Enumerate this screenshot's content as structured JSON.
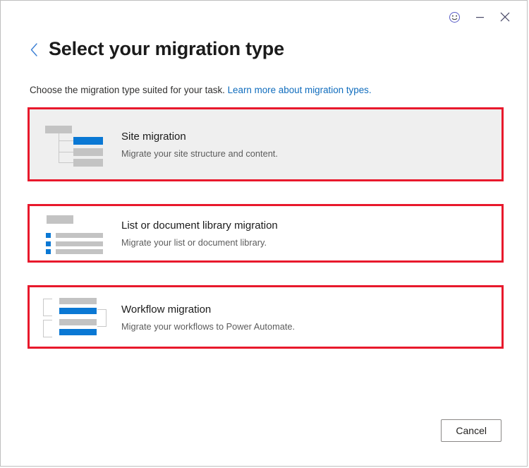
{
  "window": {
    "controls": [
      {
        "name": "feedback-smiley-button",
        "icon": "smiley-icon",
        "title": "Send feedback"
      },
      {
        "name": "minimize-button",
        "icon": "minimize-icon",
        "title": "Minimize"
      },
      {
        "name": "close-button",
        "icon": "close-icon",
        "title": "Close"
      }
    ]
  },
  "header": {
    "back_icon": "chevron-left-icon",
    "title": "Select your migration type"
  },
  "subtitle": {
    "text": "Choose the migration type suited for your task. ",
    "link_text": "Learn more about migration types."
  },
  "options": [
    {
      "id": "site-migration",
      "title": "Site migration",
      "description": "Migrate your site structure and content.",
      "icon": "site-tree-icon",
      "selected": true
    },
    {
      "id": "list-or-document-library-migration",
      "title": "List or document library migration",
      "description": "Migrate your list or document library.",
      "icon": "bulleted-list-icon",
      "selected": false
    },
    {
      "id": "workflow-migration",
      "title": "Workflow migration",
      "description": "Migrate your workflows to Power Automate.",
      "icon": "workflow-branch-icon",
      "selected": false
    }
  ],
  "footer": {
    "cancel_label": "Cancel"
  },
  "colors": {
    "accent_blue": "#0a78d4",
    "link_blue": "#0f6cbd",
    "annotation_red": "#e8192c",
    "selected_card_bg": "#efefef",
    "illustration_gray": "#c3c3c3"
  }
}
